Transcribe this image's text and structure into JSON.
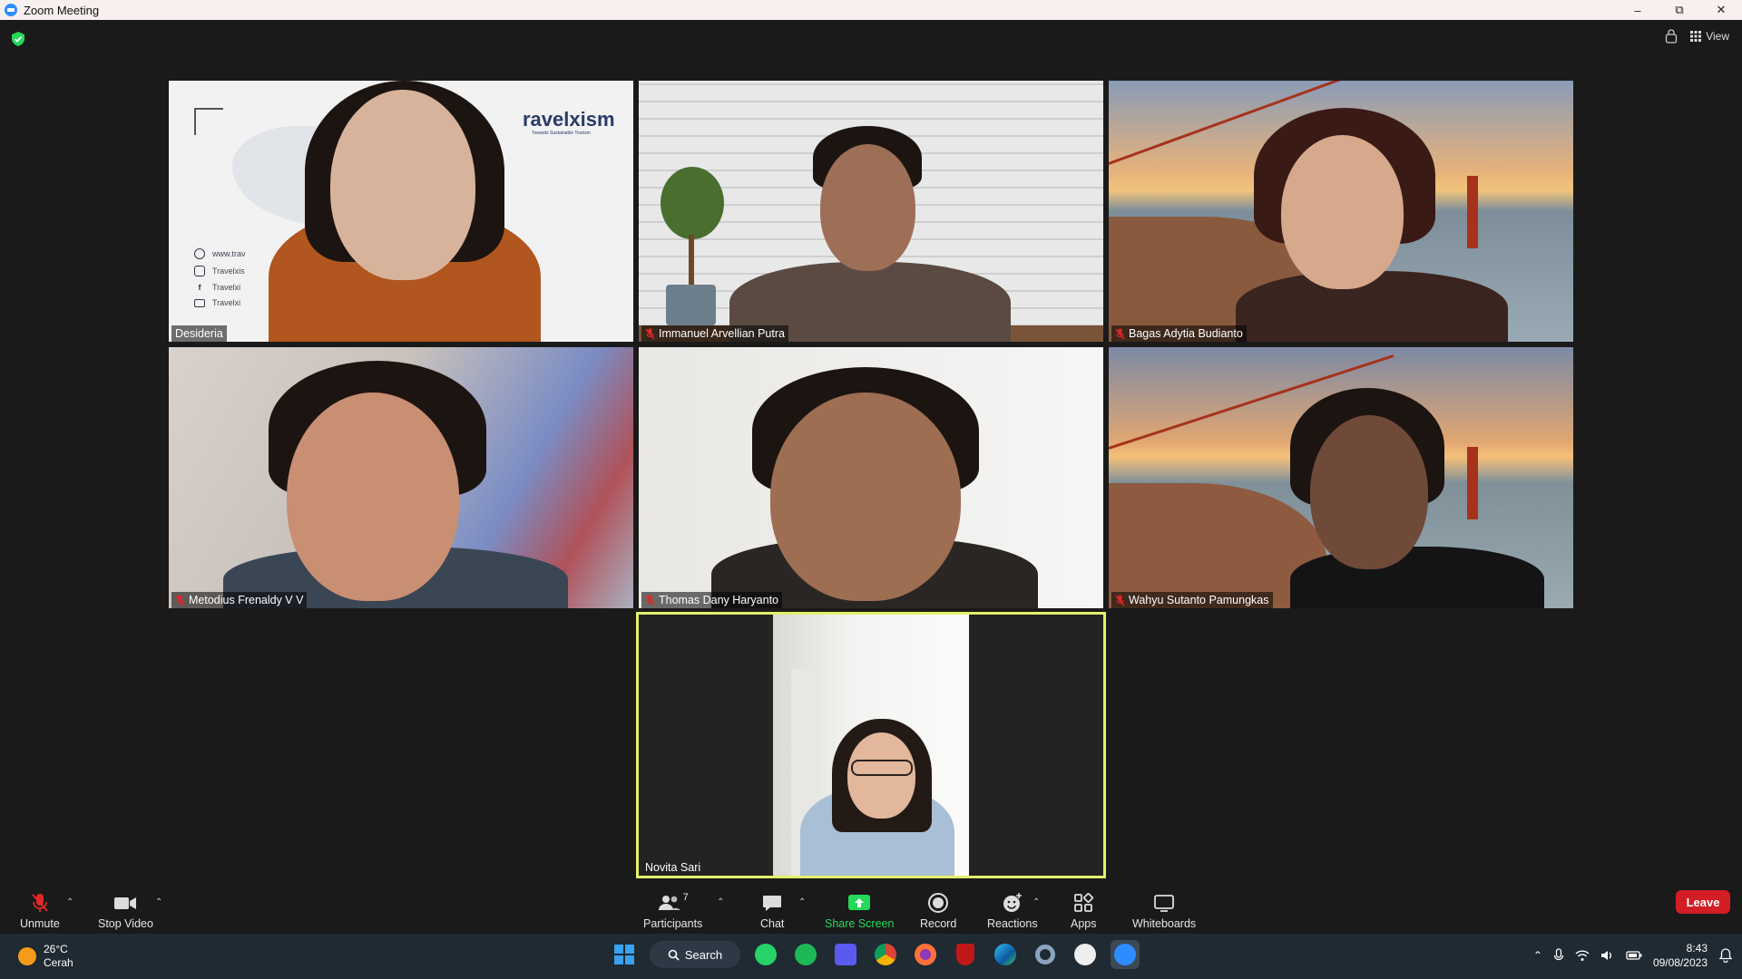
{
  "window": {
    "title": "Zoom Meeting"
  },
  "top_right": {
    "view_label": "View"
  },
  "tiles": [
    {
      "name": "Desideria",
      "muted": false
    },
    {
      "name": "Immanuel Arvellian Putra",
      "muted": true
    },
    {
      "name": "Bagas Adytia Budianto",
      "muted": true
    },
    {
      "name": "Metodius Frenaldy V V",
      "muted": true
    },
    {
      "name": "Thomas Dany Haryanto",
      "muted": true
    },
    {
      "name": "Wahyu Sutanto Pamungkas",
      "muted": true
    },
    {
      "name": "Novita Sari",
      "muted": false,
      "active_speaker": true
    }
  ],
  "desideria_bg": {
    "brand": "ravelxism",
    "tagline": "Towards Sustainable Tourism",
    "lines": [
      "www.trav",
      "Travelxis",
      "Travelxi",
      "Travelxi"
    ]
  },
  "toolbar": {
    "unmute": "Unmute",
    "stop_video": "Stop Video",
    "participants": "Participants",
    "participants_count": "7",
    "chat": "Chat",
    "share_screen": "Share Screen",
    "record": "Record",
    "reactions": "Reactions",
    "apps": "Apps",
    "whiteboards": "Whiteboards",
    "leave": "Leave"
  },
  "taskbar": {
    "temperature": "26°C",
    "condition": "Cerah",
    "search": "Search",
    "time": "8:43",
    "date": "09/08/2023"
  },
  "colors": {
    "share_green": "#23d959",
    "leave_red": "#d21e24",
    "active_border": "#e4f06a"
  }
}
